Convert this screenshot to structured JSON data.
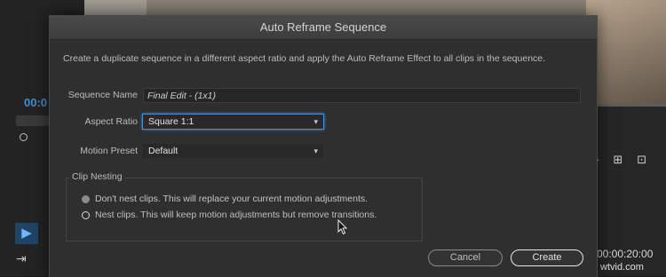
{
  "dialog": {
    "title": "Auto Reframe Sequence",
    "description": "Create a duplicate sequence in a different aspect ratio and apply the Auto Reframe Effect to all clips in the sequence.",
    "sequence_name_label": "Sequence Name",
    "sequence_name_value": "Final Edit - (1x1)",
    "aspect_ratio_label": "Aspect Ratio",
    "aspect_ratio_value": "Square 1:1",
    "motion_preset_label": "Motion Preset",
    "motion_preset_value": "Default",
    "clip_nesting_label": "Clip Nesting",
    "option_dont_nest": "Don't nest clips. This will replace your current motion adjustments.",
    "option_nest": "Nest clips. This will keep motion adjustments but remove transitions.",
    "selected_option": "nest",
    "cancel_label": "Cancel",
    "create_label": "Create",
    "focus_color": "#4d8fd4"
  },
  "background": {
    "timecode_left": "00:0",
    "timecode_right": "00:00:20:00",
    "watermark": "wtvid.com",
    "icons": [
      "selection-tool-icon",
      "track-select-tool-icon",
      "marker-icon",
      "insert-icon",
      "overwrite-icon"
    ]
  },
  "icons": {
    "chevron": "▾",
    "selection_tool": "▶",
    "track_select": "⇥"
  }
}
